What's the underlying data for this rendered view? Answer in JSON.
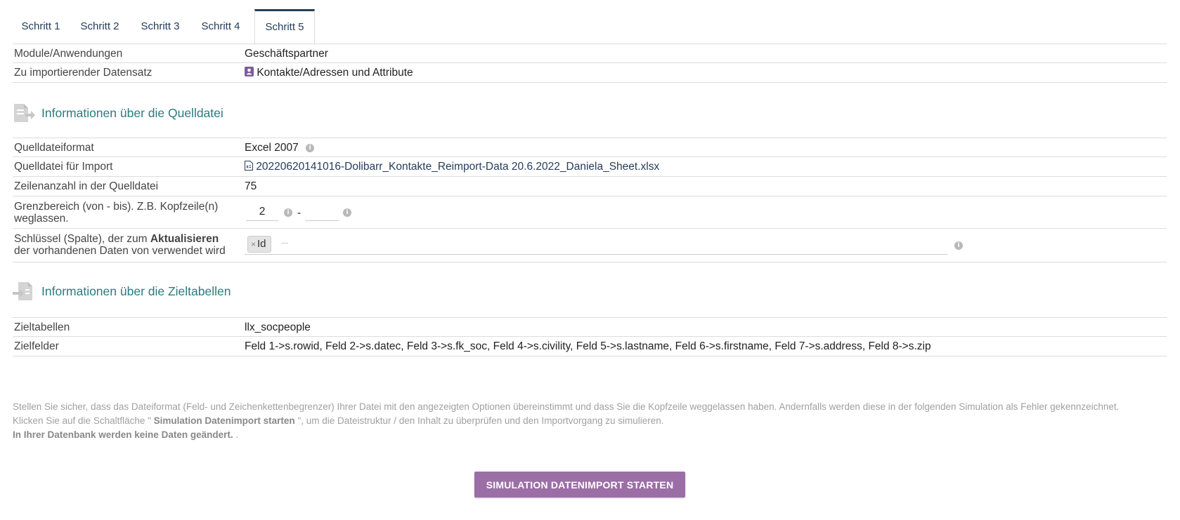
{
  "tabs": [
    {
      "label": "Schritt 1"
    },
    {
      "label": "Schritt 2"
    },
    {
      "label": "Schritt 3"
    },
    {
      "label": "Schritt 4"
    },
    {
      "label": "Schritt 5",
      "active": true
    }
  ],
  "general": {
    "module_label": "Module/Anwendungen",
    "module_value": "Geschäftspartner",
    "dataset_label": "Zu importierender Datensatz",
    "dataset_value": "Kontakte/Adressen und Attribute"
  },
  "source_section": {
    "title": "Informationen über die Quelldatei",
    "format_label": "Quelldateiformat",
    "format_value": "Excel 2007",
    "file_label": "Quelldatei für Import",
    "file_value": "20220620141016-Dolibarr_Kontakte_Reimport-Data 20.6.2022_Daniela_Sheet.xlsx",
    "rows_label": "Zeilenanzahl in der Quelldatei",
    "rows_value": "75",
    "range_label_1": "Grenzbereich (von - bis). Z.B. Kopfzeile(n)",
    "range_label_2": "weglassen.",
    "range_from": "2",
    "range_separator": "-",
    "range_to": "",
    "key_label_pre": "Schlüssel (Spalte), der zum ",
    "key_label_bold": "Aktualisieren",
    "key_label_2": "der vorhandenen Daten von verwendet wird",
    "key_tag": "Id",
    "key_tag_remove": "×"
  },
  "target_section": {
    "title": "Informationen über die Zieltabellen",
    "tables_label": "Zieltabellen",
    "tables_value": "llx_socpeople",
    "fields_label": "Zielfelder",
    "fields_value": "Feld 1->s.rowid, Feld 2->s.datec, Feld 3->s.fk_soc, Feld 4->s.civility, Feld 5->s.lastname, Feld 6->s.firstname, Feld 7->s.address, Feld 8->s.zip"
  },
  "notes": {
    "line1": "Stellen Sie sicher, dass das Dateiformat (Feld- und Zeichenkettenbegrenzer) Ihrer Datei mit den angezeigten Optionen übereinstimmt und dass Sie die Kopfzeile weggelassen haben. Andernfalls werden diese in der folgenden Simulation als Fehler gekennzeichnet.",
    "line2_pre": "Klicken Sie auf die Schaltfläche \" ",
    "line2_bold": "Simulation Datenimport starten",
    "line2_post": " \", um die Dateistruktur / den Inhalt zu überprüfen und den Importvorgang zu simulieren.",
    "line3_bold": "In Ihrer Datenbank werden keine Daten geändert.",
    "line3_post": " ."
  },
  "actions": {
    "simulate_label": "SIMULATION DATENIMPORT STARTEN"
  },
  "colors": {
    "accent_teal": "#2b7c80",
    "tab_text": "#263c5c",
    "button_bg": "#9c6ea6",
    "dataset_icon": "#7c5c9c"
  },
  "icons": {
    "dataset": "contact-card-icon",
    "file": "spreadsheet-file-icon",
    "info": "info-icon",
    "source_section": "file-export-icon",
    "target_section": "file-import-icon"
  }
}
